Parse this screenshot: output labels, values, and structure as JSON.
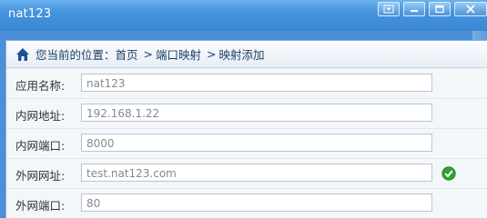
{
  "window": {
    "title": "nat123"
  },
  "breadcrumb": {
    "prefix": "您当前的位置：",
    "items": [
      "首页",
      "端口映射",
      "映射添加"
    ],
    "separator": ">"
  },
  "form": {
    "fields": [
      {
        "label": "应用名称:",
        "value": "nat123",
        "valid": false
      },
      {
        "label": "内网地址:",
        "value": "192.168.1.22",
        "valid": false
      },
      {
        "label": "内网端口:",
        "value": "8000",
        "valid": false
      },
      {
        "label": "外网网址:",
        "value": "test.nat123.com",
        "valid": true
      },
      {
        "label": "外网端口:",
        "value": "80",
        "valid": false
      }
    ]
  },
  "colors": {
    "titlebar": "#4593dd",
    "valid": "#2fa52f"
  }
}
